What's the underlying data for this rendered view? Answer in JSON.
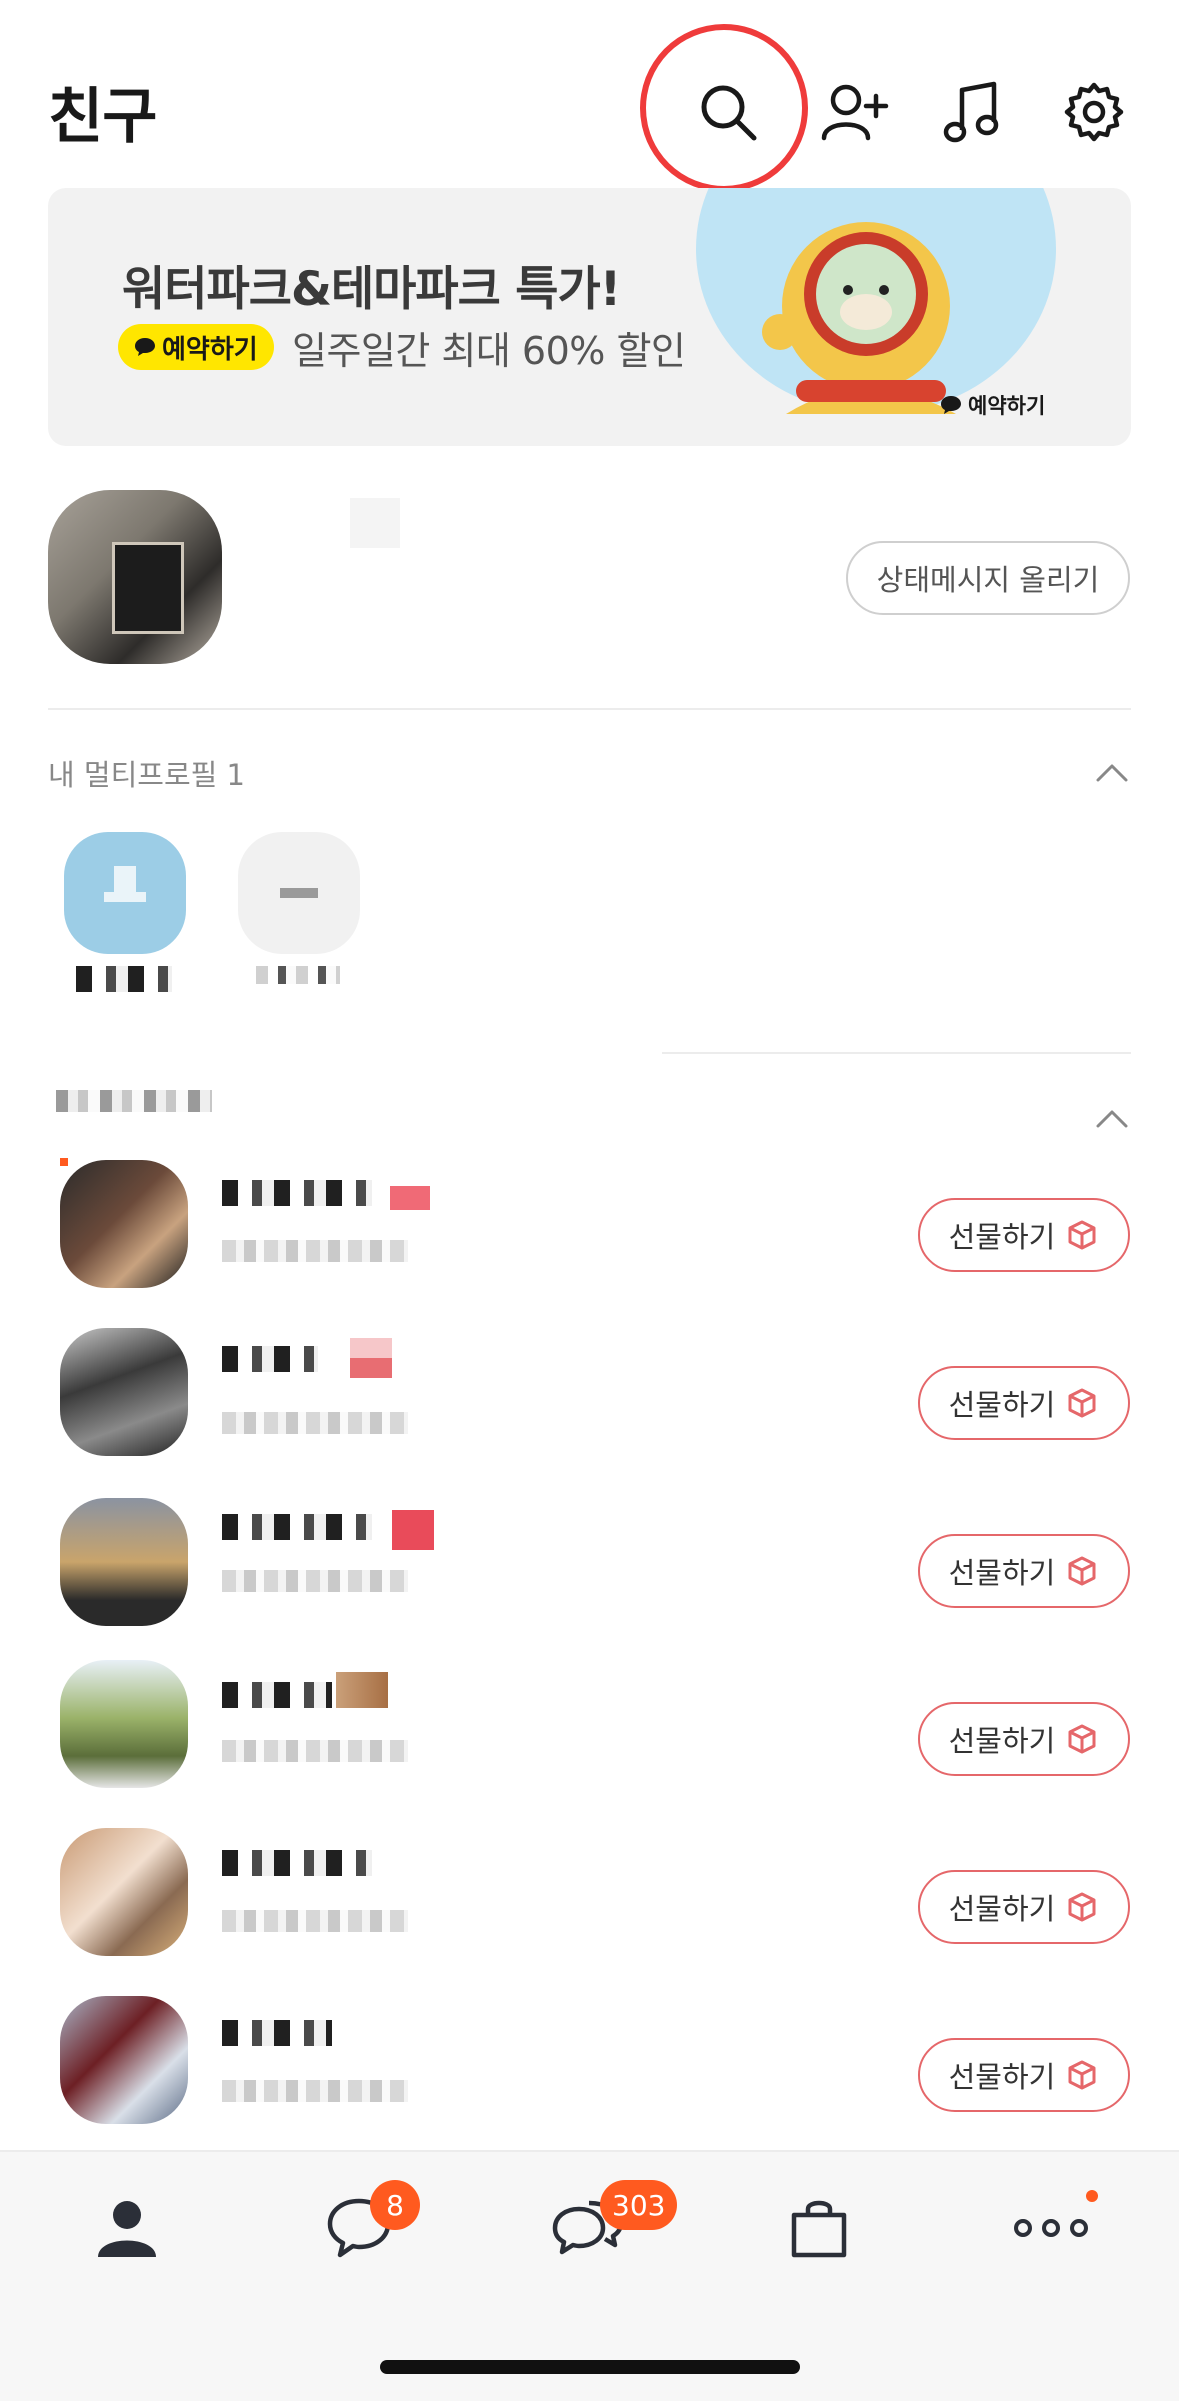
{
  "header": {
    "title": "친구"
  },
  "banner": {
    "title": "워터파크&테마파크 특가!",
    "pill_label": "예약하기",
    "subtitle": "일주일간 최대 60% 할인",
    "small_label": "예약하기"
  },
  "profile": {
    "status_button": "상태메시지 올리기"
  },
  "multi_profile": {
    "label": "내 멀티프로필 1"
  },
  "friends": {
    "gift_label": "선물하기"
  },
  "nav": {
    "chats_badge": "8",
    "openchat_badge": "303"
  },
  "colors": {
    "accent_red": "#e5676a",
    "badge_orange": "#ff5a1f",
    "pill_yellow": "#ffe600",
    "annotation_circle": "#ef3b3b"
  }
}
